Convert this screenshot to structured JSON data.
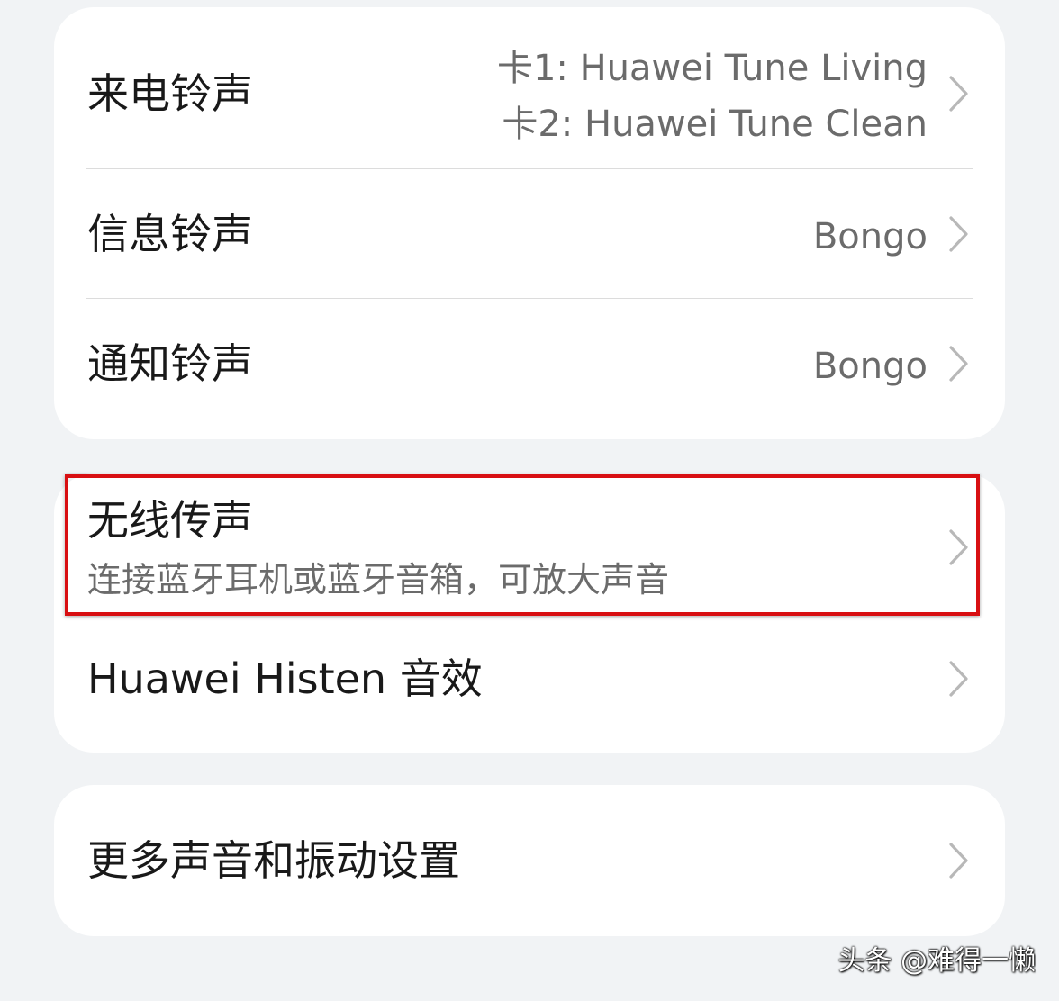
{
  "ringtones": {
    "incoming_call": {
      "label": "来电铃声",
      "value_line1": "卡1: Huawei Tune Living",
      "value_line2": "卡2: Huawei Tune Clean"
    },
    "message": {
      "label": "信息铃声",
      "value": "Bongo"
    },
    "notification": {
      "label": "通知铃声",
      "value": "Bongo"
    }
  },
  "sound": {
    "wireless_projection": {
      "label": "无线传声",
      "subtitle": "连接蓝牙耳机或蓝牙音箱，可放大声音"
    },
    "histen": {
      "label": "Huawei Histen 音效"
    }
  },
  "more": {
    "label": "更多声音和振动设置"
  },
  "watermark": "头条 @难得一懒",
  "colors": {
    "background": "#f1f3f5",
    "card": "#ffffff",
    "primary_text": "#191919",
    "secondary_text": "#6b6b6b",
    "highlight": "#d80f12"
  },
  "icons": {
    "chevron": "chevron-right-icon"
  }
}
